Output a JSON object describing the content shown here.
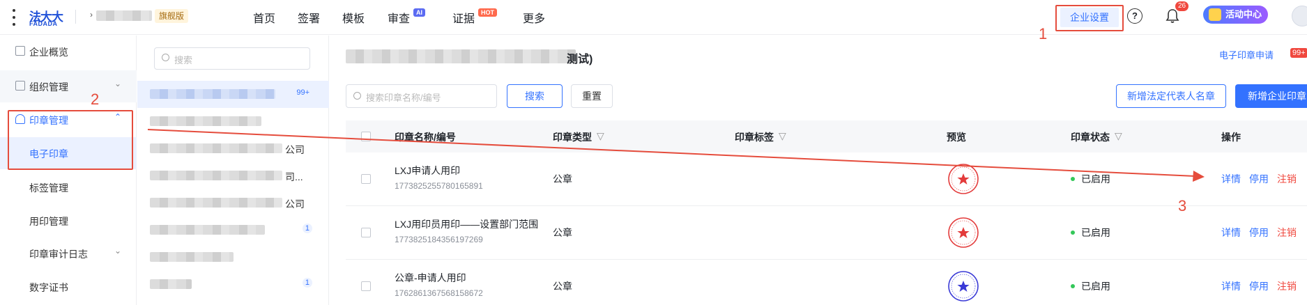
{
  "header": {
    "logo_cn": "法大大",
    "logo_en": "FADADA",
    "edition_badge": "旗舰版",
    "nav": [
      {
        "label": "首页"
      },
      {
        "label": "签署"
      },
      {
        "label": "模板"
      },
      {
        "label": "审查",
        "badge": "AI"
      },
      {
        "label": "证据",
        "badge": "HOT"
      },
      {
        "label": "更多"
      }
    ],
    "enterprise_settings": "企业设置",
    "help_icon": "?",
    "notification_count": "26",
    "activity_center": "活动中心"
  },
  "sidebar": {
    "items": [
      {
        "label": "企业概览",
        "icon": "overview-icon"
      },
      {
        "label": "组织管理",
        "icon": "org-icon"
      },
      {
        "label": "印章管理",
        "icon": "seal-icon"
      },
      {
        "label": "电子印章"
      },
      {
        "label": "标签管理"
      },
      {
        "label": "用印管理"
      },
      {
        "label": "印章审计日志"
      },
      {
        "label": "数字证书"
      }
    ]
  },
  "middle": {
    "search_placeholder": "搜索",
    "rows": [
      {
        "suffix": "",
        "count": "99+"
      },
      {
        "suffix": "",
        "count": ""
      },
      {
        "suffix": "公司",
        "count": ""
      },
      {
        "suffix": "司...",
        "count": ""
      },
      {
        "suffix": "公司",
        "count": ""
      },
      {
        "suffix": "",
        "count": "1"
      },
      {
        "suffix": "",
        "count": ""
      },
      {
        "suffix": "",
        "count": "1"
      }
    ]
  },
  "main": {
    "title_suffix": "测试)",
    "apply_link": "电子印章申请",
    "apply_badge": "99+",
    "search_placeholder": "搜索印章名称/编号",
    "search_button": "搜索",
    "reset_button": "重置",
    "add_legal_button": "新增法定代表人名章",
    "add_enterprise_button": "新增企业印章",
    "columns": {
      "name": "印章名称/编号",
      "type": "印章类型",
      "tag": "印章标签",
      "preview": "预览",
      "status": "印章状态",
      "actions": "操作"
    },
    "rows": [
      {
        "name": "LXJ申请人用印",
        "code": "1773825255780165891",
        "type": "公章",
        "status": "已启用",
        "seal_color": "#e33b3b"
      },
      {
        "name": "LXJ用印员用印——设置部门范围",
        "code": "1773825184356197269",
        "type": "公章",
        "status": "已启用",
        "seal_color": "#e33b3b"
      },
      {
        "name": "公章-申请人用印",
        "code": "1762861367568158672",
        "type": "公章",
        "status": "已启用",
        "seal_color": "#3a3ad6"
      }
    ],
    "actions": {
      "detail": "详情",
      "disable": "停用",
      "cancel": "注销"
    }
  },
  "annotations": {
    "step1": "1",
    "step2": "2",
    "step3": "3",
    "color": "#e54c3c"
  }
}
